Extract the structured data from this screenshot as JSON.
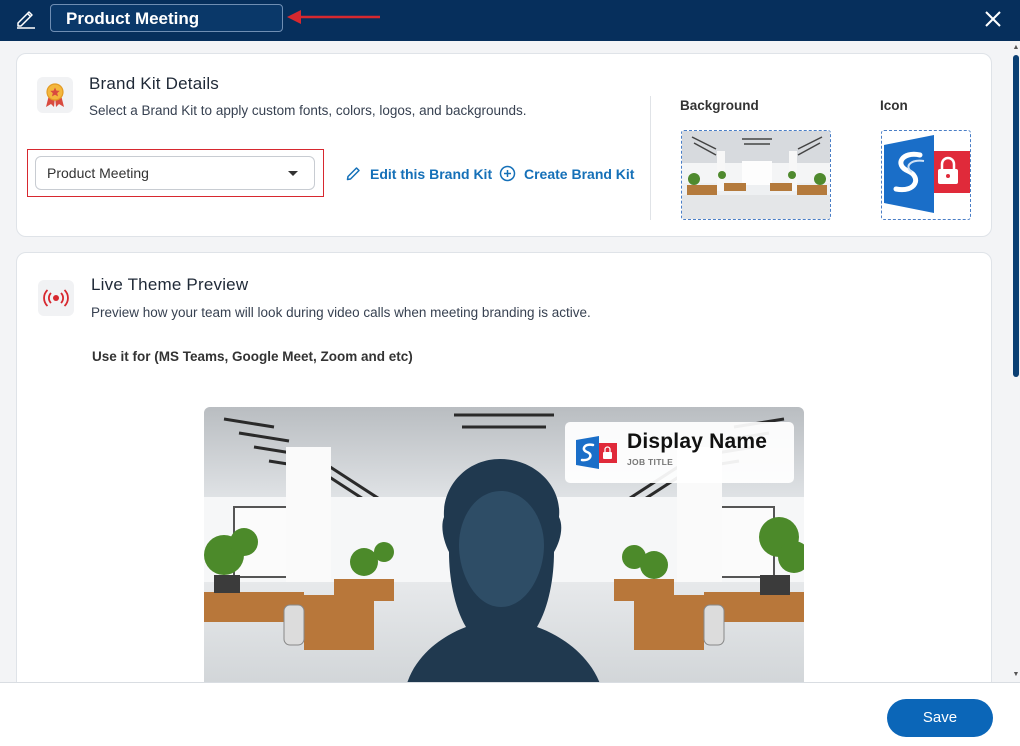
{
  "header": {
    "title_value": "Product Meeting",
    "edit_icon": "pencil-icon",
    "close_icon": "close-icon",
    "accent_color": "#062f5c",
    "annotation_color": "#d7282f"
  },
  "brand_kit": {
    "title": "Brand Kit Details",
    "description": "Select a Brand Kit to apply custom fonts, colors, logos, and backgrounds.",
    "selected_kit": "Product Meeting",
    "edit_link": "Edit this Brand Kit",
    "create_link": "Create Brand Kit",
    "background_label": "Background",
    "icon_label": "Icon",
    "icon": "ribbon-award-icon"
  },
  "live_preview": {
    "title": "Live Theme Preview",
    "description": "Preview how your team will look during video calls when meeting branding is active.",
    "usage": "Use it for (MS Teams, Google Meet, Zoom and etc)",
    "icon": "broadcast-icon",
    "display_name": "Display Name",
    "job_title": "JOB TITLE"
  },
  "footer": {
    "save_label": "Save"
  }
}
